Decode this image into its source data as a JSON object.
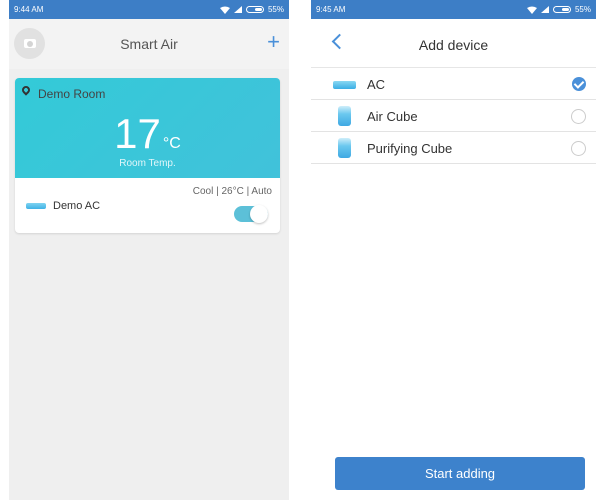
{
  "left_screen": {
    "status": {
      "time": "9:44 AM",
      "battery": "55%"
    },
    "header": {
      "title": "Smart Air"
    },
    "room": {
      "name": "Demo Room",
      "temperature": "17",
      "unit": "°C",
      "label": "Room Temp."
    },
    "device": {
      "name": "Demo AC",
      "status": "Cool | 26°C | Auto",
      "toggle_on": true
    }
  },
  "right_screen": {
    "status": {
      "time": "9:45 AM",
      "battery": "55%"
    },
    "header": {
      "title": "Add device"
    },
    "devices": [
      {
        "label": "AC",
        "icon": "ac-icon",
        "selected": true
      },
      {
        "label": "Air Cube",
        "icon": "air-cube-icon",
        "selected": false
      },
      {
        "label": "Purifying Cube",
        "icon": "purifying-cube-icon",
        "selected": false
      }
    ],
    "start_button": "Start adding"
  },
  "colors": {
    "accent": "#4a90d9",
    "status_bar": "#3d7ec6",
    "room_card": "#3ac6d9",
    "toggle": "#5cc0d8"
  }
}
